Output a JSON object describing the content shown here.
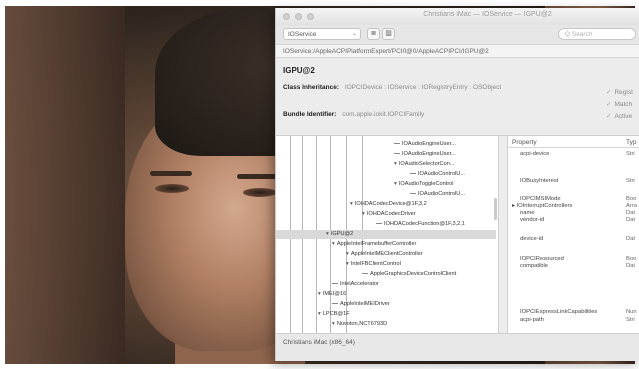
{
  "window": {
    "title": "Christians iMac — IOService — IGPU@2"
  },
  "toolbar": {
    "plane": "IOService",
    "search_placeholder": "Q Search"
  },
  "path": "IOService:/AppleACPIPlatformExpert/PCI0@0/AppleACPIPCI/IGPU@2",
  "node": {
    "title": "IGPU@2",
    "class_label": "Class Inheritance:",
    "class_value": "IOPCIDevice : IOService : IORegistryEntry : OSObject",
    "bundle_label": "Bundle Identifier:",
    "bundle_value": "com.apple.iokit.IOPCIFamily"
  },
  "checks": [
    "Regist",
    "Match",
    "Active"
  ],
  "tree": [
    "IOAudioEngineUser...",
    "IOAudioEngineUser...",
    "IOAudioSelectorCon...",
    "IOAudioControlU...",
    "IOAudioToggleControl",
    "IOAudioControlU...",
    "IOHDACodecDevice@1F,3,2",
    "IOHDACodecDriver",
    "IOHDACodecFunction@1F,3,2,1",
    "IGPU@2",
    "AppleIntelFramebufferController",
    "AppleIntelMEClientController",
    "IntelFBClientControl",
    "AppleGraphicsDeviceControlClient",
    "IntelAccelerator",
    "IMEI@16",
    "AppleIntelMEIDriver",
    "LPCB@1F",
    "Nuvoton,NCT6793D"
  ],
  "props": {
    "col_property": "Property",
    "col_type": "Typ",
    "rows": [
      {
        "name": "acpi-device",
        "type": "Stri"
      },
      {
        "name": "IOBusyInterest",
        "type": "Stri"
      },
      {
        "name": "IOPCIMSIMode",
        "type": "Boo"
      },
      {
        "name": "IOInterruptControllers",
        "type": "Arra"
      },
      {
        "name": "name",
        "type": "Dat"
      },
      {
        "name": "vendor-id",
        "type": "Dat"
      },
      {
        "name": "device-id",
        "type": "Dat"
      },
      {
        "name": "IOPCIResourced",
        "type": "Boo"
      },
      {
        "name": "compatible",
        "type": "Dat"
      },
      {
        "name": "IOPCIExpressLinkCapabilities",
        "type": "Nun"
      },
      {
        "name": "acpi-path",
        "type": "Stri"
      }
    ]
  },
  "status": "Christians iMac (x86_64)"
}
